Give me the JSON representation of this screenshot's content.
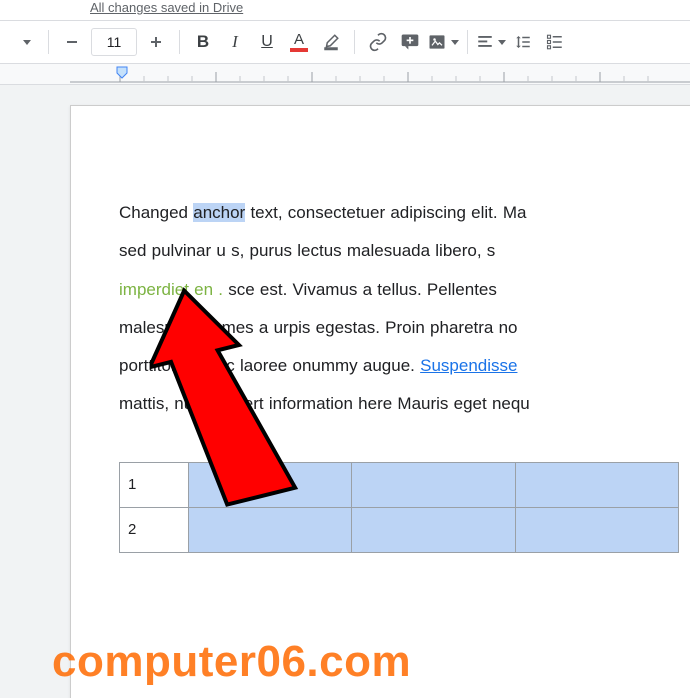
{
  "status": {
    "text": "All changes saved in Drive"
  },
  "toolbar": {
    "font_size": "11",
    "bold": "B",
    "italic": "I",
    "underline": "U",
    "textcolor": "A"
  },
  "document": {
    "line1_pre": "Changed ",
    "line1_sel": "anchor",
    "line1_post": " text, consectetuer adipiscing elit. Ma",
    "line2": "sed pulvinar u         s, purus lectus malesuada libero, s",
    "line3_green": "imperdiet en     .",
    "line3_black": "    sce est. Vivamus a tellus. Pellentes",
    "line4": "malesuada fames a    urpis egestas. Proin pharetra no",
    "line5_a": "porttitor. Donec laoree    onummy augue. ",
    "line5_link": "Suspendisse",
    "line6": "mattis, nunc. Insert information here Mauris eget nequ",
    "table": {
      "rows": [
        {
          "num": "1"
        },
        {
          "num": "2"
        }
      ]
    }
  },
  "watermark": "computer06.com"
}
